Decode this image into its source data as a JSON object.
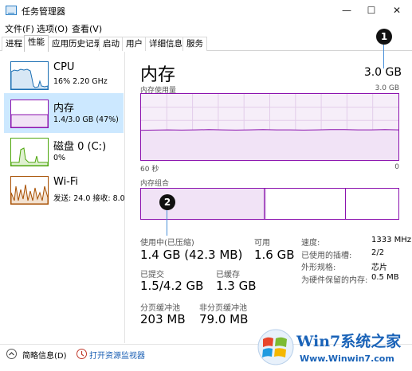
{
  "window": {
    "title": "任务管理器",
    "minimize": "—",
    "maximize": "☐",
    "close": "✕"
  },
  "menu": [
    "文件(F)",
    "选项(O)",
    "查看(V)"
  ],
  "tabs": [
    "进程",
    "性能",
    "应用历史记录",
    "启动",
    "用户",
    "详细信息",
    "服务"
  ],
  "sidebar": {
    "items": [
      {
        "title": "CPU",
        "sub": "16% 2.20 GHz",
        "color": "#1b6fb3"
      },
      {
        "title": "内存",
        "sub": "1.4/3.0 GB (47%)",
        "color": "#8b12ae"
      },
      {
        "title": "磁盘 0 (C:)",
        "sub": "0%",
        "color": "#4da60c"
      },
      {
        "title": "Wi-Fi",
        "sub": "发送: 24.0  接收: 8.0",
        "color": "#a74f01"
      }
    ]
  },
  "main": {
    "title": "内存",
    "total": "3.0 GB",
    "usage_label": "内存使用量",
    "usage_max": "3.0 GB",
    "time_left": "60 秒",
    "time_right": "0",
    "composition_label": "内存组合",
    "stats": {
      "in_use_label": "使用中(已压缩)",
      "in_use_value": "1.4 GB (42.3 MB)",
      "available_label": "可用",
      "available_value": "1.6 GB",
      "committed_label": "已提交",
      "committed_value": "1.5/4.2 GB",
      "cached_label": "已缓存",
      "cached_value": "1.3 GB",
      "paged_label": "分页缓冲池",
      "paged_value": "203 MB",
      "nonpaged_label": "非分页缓冲池",
      "nonpaged_value": "79.0 MB"
    },
    "right_stats": [
      {
        "label": "速度:",
        "value": "1333 MHz"
      },
      {
        "label": "已使用的插槽:",
        "value": "2/2"
      },
      {
        "label": "外形规格:",
        "value": "芯片"
      },
      {
        "label": "为硬件保留的内存:",
        "value": "0.5 MB"
      }
    ]
  },
  "footer": {
    "summary_label": "简略信息(D)",
    "monitor_link": "打开资源监视器"
  },
  "callouts": [
    "1",
    "2"
  ],
  "watermark": {
    "brand": "Win7系统之家",
    "url": "Www.Winwin7.com"
  },
  "chart_data": {
    "type": "line",
    "title": "内存使用量",
    "series": [
      {
        "name": "内存使用量",
        "values": [
          1.35,
          1.36,
          1.37,
          1.36,
          1.37,
          1.38,
          1.37,
          1.36,
          1.37,
          1.38,
          1.37,
          1.37,
          1.36,
          1.37,
          1.38,
          1.38,
          1.37,
          1.37,
          1.38,
          1.37
        ]
      }
    ],
    "x_range_seconds": [
      60,
      0
    ],
    "ylim": [
      0,
      3.0
    ],
    "grid": true
  }
}
